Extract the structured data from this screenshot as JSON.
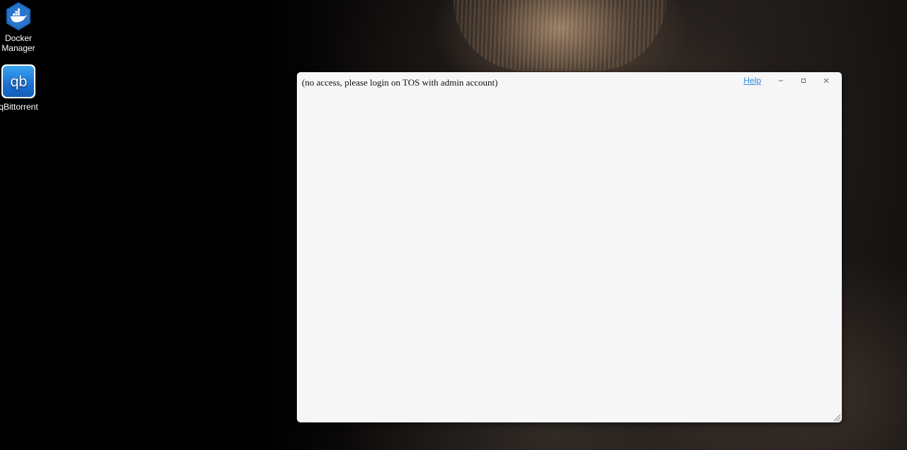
{
  "desktop": {
    "icons": [
      {
        "label_line1": "Docker",
        "label_line2": "Manager",
        "icon": "docker-whale-icon",
        "color": "#1d63b8"
      },
      {
        "label": "qBittorrent",
        "icon": "qbittorrent-icon",
        "glyph": "qb",
        "color": "#1a6fd0"
      }
    ]
  },
  "window": {
    "message": "(no access, please login on TOS with admin account)",
    "help_label": "Help",
    "controls": [
      "minimize-icon",
      "maximize-icon",
      "close-icon"
    ],
    "accent_color": "#2a8ae0",
    "background_color": "#f6f6f6"
  }
}
